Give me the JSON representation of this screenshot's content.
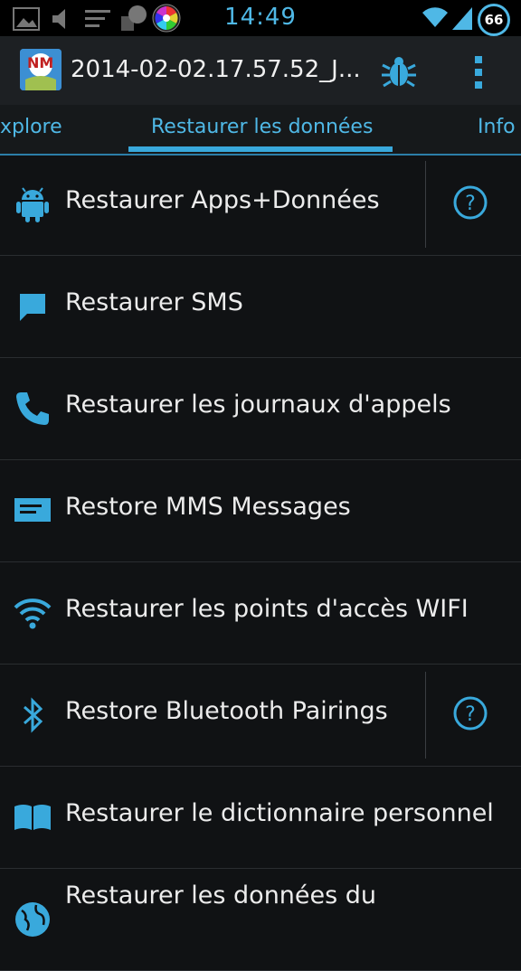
{
  "status_bar": {
    "time": "14:49",
    "battery_level": "66",
    "icons": [
      "gallery-icon",
      "mute-icon",
      "notes-icon",
      "profile-icon",
      "color-wheel-icon",
      "wifi-icon",
      "signal-icon",
      "battery-icon"
    ]
  },
  "action_bar": {
    "logo_text": "NM",
    "title": "2014-02-02.17.57.52_J...",
    "icons": [
      "bug-icon",
      "overflow-menu-icon"
    ]
  },
  "tabs": [
    {
      "label": "xplore"
    },
    {
      "label": "Restaurer les données",
      "selected": true
    },
    {
      "label": "Info"
    }
  ],
  "accent_color": "#39a9dc",
  "list": [
    {
      "label": "Restaurer Apps+Données",
      "icon": "android-icon",
      "help": true
    },
    {
      "label": "Restaurer SMS",
      "icon": "sms-icon",
      "help": false
    },
    {
      "label": "Restaurer les journaux d'appels",
      "icon": "phone-icon",
      "help": false
    },
    {
      "label": "Restore MMS Messages",
      "icon": "mms-icon",
      "help": false
    },
    {
      "label": "Restaurer les points d'accès WIFI",
      "icon": "wifi-icon",
      "help": false
    },
    {
      "label": "Restore Bluetooth Pairings",
      "icon": "bluetooth-icon",
      "help": true
    },
    {
      "label": "Restaurer le dictionnaire personnel",
      "icon": "book-icon",
      "help": false
    },
    {
      "label": "Restaurer les données du",
      "icon": "globe-icon",
      "help": false
    }
  ]
}
